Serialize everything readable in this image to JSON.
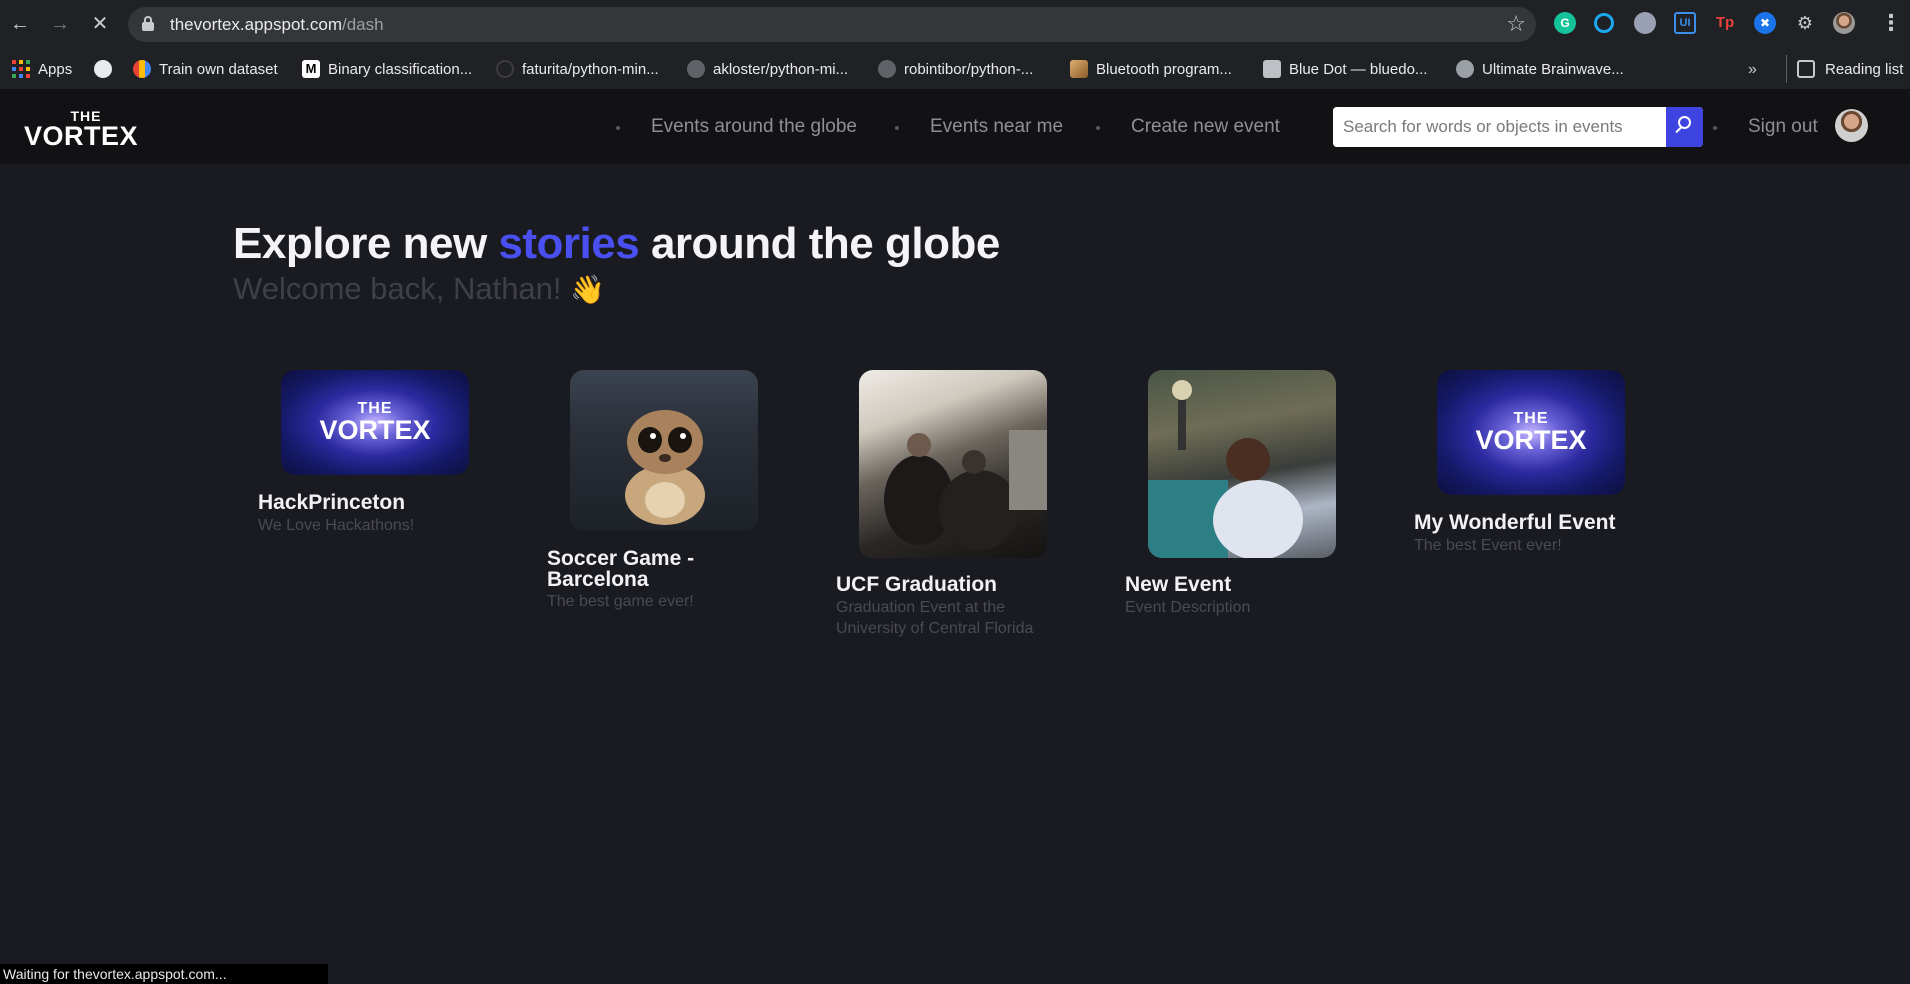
{
  "browser": {
    "url_host": "thevortex.appspot.com",
    "url_path": "/dash",
    "bookmarks": [
      {
        "label": "Apps",
        "icon": "apps-grid-icon"
      },
      {
        "label": "",
        "icon": "globe-icon"
      },
      {
        "label": "Train own dataset",
        "icon": "google-cloud-icon"
      },
      {
        "label": "Binary classification...",
        "icon": "medium-icon"
      },
      {
        "label": "faturita/python-min...",
        "icon": "github-icon"
      },
      {
        "label": "akloster/python-mi...",
        "icon": "github-icon"
      },
      {
        "label": "robintibor/python-...",
        "icon": "github-icon"
      },
      {
        "label": "Bluetooth program...",
        "icon": "bookmark-image-icon"
      },
      {
        "label": "Blue Dot — bluedo...",
        "icon": "docs-icon"
      },
      {
        "label": "Ultimate Brainwave...",
        "icon": "instructables-icon"
      }
    ],
    "reading_list": "Reading list",
    "status": "Waiting for thevortex.appspot.com..."
  },
  "site": {
    "logo_the": "THE",
    "logo_vortex": "VORTEX",
    "nav": [
      "Events around the globe",
      "Events near me",
      "Create new event"
    ],
    "search_placeholder": "Search for words or objects in events",
    "signout": "Sign out"
  },
  "main": {
    "headline_pre": "Explore new",
    "headline_accent": "stories",
    "headline_post": "around the globe",
    "accent_color": "#4a4ff0",
    "welcome": "Welcome back, Nathan!",
    "wave_emoji": "👋"
  },
  "events": [
    {
      "title": "HackPrinceton",
      "description": "We Love Hackathons!",
      "image": "vortex-logo"
    },
    {
      "title": "Soccer Game - Barcelona",
      "description": "The best game ever!",
      "image": "mongoose-cartoon"
    },
    {
      "title": "UCF Graduation",
      "description": "Graduation Event at the University of Central Florida",
      "image": "graduation-crowd"
    },
    {
      "title": "New Event",
      "description": "Event Description",
      "image": "party-photo"
    },
    {
      "title": "My Wonderful Event",
      "description": "The best Event ever!",
      "image": "vortex-logo"
    }
  ],
  "thumb_text": {
    "the": "THE",
    "vortex": "VORTEX"
  }
}
